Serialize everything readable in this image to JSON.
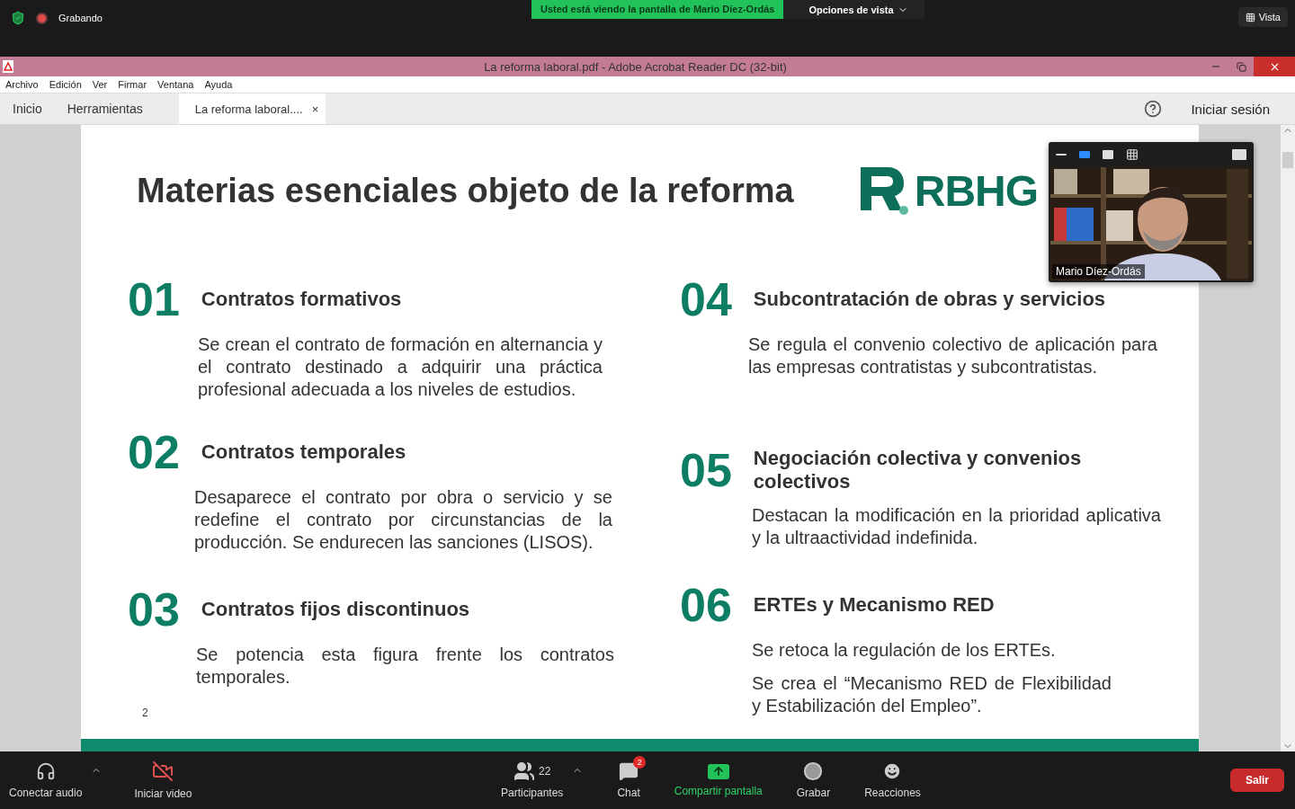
{
  "meeting_bar": {
    "recording": "Grabando",
    "banner": "Usted está viendo la pantalla de Mario Díez-Ordás",
    "view_options": "Opciones de vista",
    "view": "Vista"
  },
  "acrobat": {
    "title": "La reforma laboral.pdf - Adobe Acrobat Reader DC (32-bit)",
    "menu": [
      "Archivo",
      "Edición",
      "Ver",
      "Firmar",
      "Ventana",
      "Ayuda"
    ],
    "tabs": [
      {
        "label": "Inicio",
        "selected": false,
        "kind": "nav"
      },
      {
        "label": "Herramientas",
        "selected": false,
        "kind": "nav"
      },
      {
        "label": "La reforma laboral....",
        "selected": true,
        "kind": "document",
        "close": "×"
      }
    ],
    "sign_in": "Iniciar sesión"
  },
  "document": {
    "title": "Materias esenciales objeto de la reforma",
    "logo": "RBHG",
    "columns": [
      [
        {
          "number": "01",
          "heading": "Contratos formativos",
          "paragraphs": [
            "Se crean el contrato de formación en alternancia y el contrato destinado a adquirir una práctica profesional adecuada a los niveles de estudios."
          ]
        },
        {
          "number": "02",
          "heading": "Contratos temporales",
          "paragraphs": [
            "Desaparece el contrato por obra o servicio y se redefine el contrato por circunstancias de la producción. Se endurecen las sanciones (LISOS)."
          ]
        },
        {
          "number": "03",
          "heading": "Contratos fijos discontinuos",
          "paragraphs": [
            "Se potencia esta figura frente los contratos temporales."
          ]
        }
      ],
      [
        {
          "number": "04",
          "heading": "Subcontratación de obras y servicios",
          "paragraphs": [
            "Se regula el convenio colectivo de aplicación para las empresas contratistas y subcontratistas."
          ]
        },
        {
          "number": "05",
          "heading": "Negociación colectiva y convenios colectivos",
          "paragraphs": [
            "Destacan la modificación en la prioridad aplicativa y  la ultraactividad indefinida."
          ]
        },
        {
          "number": "06",
          "heading": "ERTEs y Mecanismo RED",
          "paragraphs": [
            "Se retoca la regulación de los ERTEs.",
            "Se crea el “Mecanismo RED de Flexibilidad y Estabilización del Empleo”."
          ]
        }
      ]
    ],
    "page_number": "2"
  },
  "video": {
    "name": "Mario Díez-Ordás"
  },
  "toolbar": {
    "items": [
      {
        "kind": "audio",
        "label": "Conectar audio",
        "menu": true
      },
      {
        "kind": "video",
        "label": "Iniciar video",
        "menu": false
      },
      {
        "kind": "participants",
        "label": "Participantes",
        "count": "22",
        "menu": true
      },
      {
        "kind": "chat",
        "label": "Chat",
        "badge": "2",
        "menu": false
      },
      {
        "kind": "share",
        "label": "Compartir pantalla",
        "menu": false
      },
      {
        "kind": "record",
        "label": "Grabar",
        "menu": false
      },
      {
        "kind": "reactions",
        "label": "Reacciones",
        "menu": false
      }
    ],
    "leave": "Salir"
  }
}
